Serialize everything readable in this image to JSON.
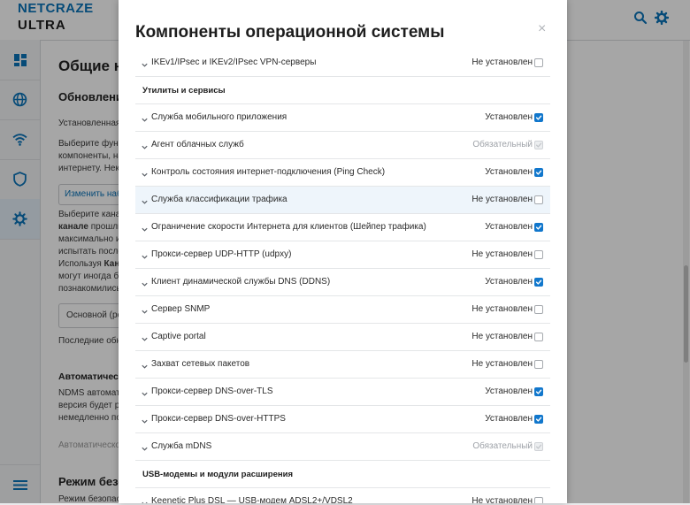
{
  "app": {
    "logo_line1": "NETCRAZE",
    "logo_line2": "ULTRA"
  },
  "topbar": {
    "icons": [
      "search-icon",
      "gear-icon"
    ]
  },
  "sidebar": {
    "items": [
      {
        "icon": "dashboard-icon"
      },
      {
        "icon": "globe-icon"
      },
      {
        "icon": "wifi-icon"
      },
      {
        "icon": "shield-icon"
      },
      {
        "icon": "gear-icon",
        "active": true
      },
      {
        "icon": "menu-icon"
      }
    ]
  },
  "background": {
    "page_title": "Общие н",
    "section_update": "Обновлени",
    "installed": "Установленная",
    "p1_l1": "Выберите функ",
    "p1_l2": "компоненты, на",
    "p1_l3": "интернету. Неко",
    "change_set_button": "Изменить набо",
    "p2_l1": "Выберите канал",
    "p2_l2_bold": "канале",
    "p2_l2": " прошли",
    "p2_l3": "максимально ис",
    "p2_l4": "испытать после",
    "p2_l5_pre": "Используя ",
    "p2_l5_bold": "Кана",
    "p2_l6": "могут иногда бы",
    "p2_l7": "познакомились",
    "channel_select": "Основной (ре",
    "last_update": "Последние обно",
    "section_auto": "Автоматическ",
    "p3_l1": "NDMS автомати",
    "p3_l2": "версия будет ра",
    "p3_l3": "немедленно пос",
    "auto_note": "Автоматическо",
    "section_safe": "Режим безо",
    "p4_l1": "Режим безопасн"
  },
  "modal": {
    "title": "Компоненты операционной системы",
    "close_label": "×",
    "rows": [
      {
        "kind": "row",
        "name": "IKEv1/IPsec и IKEv2/IPsec VPN-серверы",
        "status": "Не установлен",
        "state": "off"
      },
      {
        "kind": "section",
        "name": "Утилиты и сервисы"
      },
      {
        "kind": "row",
        "name": "Служба мобильного приложения",
        "status": "Установлен",
        "state": "on"
      },
      {
        "kind": "row",
        "name": "Агент облачных служб",
        "status": "Обязательный",
        "state": "disabled"
      },
      {
        "kind": "row",
        "name": "Контроль состояния интернет-подключения (Ping Check)",
        "status": "Установлен",
        "state": "on"
      },
      {
        "kind": "row",
        "name": "Служба классификации трафика",
        "status": "Не установлен",
        "state": "off",
        "highlight": true
      },
      {
        "kind": "row",
        "name": "Ограничение скорости Интернета для клиентов (Шейпер трафика)",
        "status": "Установлен",
        "state": "on"
      },
      {
        "kind": "row",
        "name": "Прокси-сервер UDP-HTTP (udpxy)",
        "status": "Не установлен",
        "state": "off"
      },
      {
        "kind": "row",
        "name": "Клиент динамической службы DNS (DDNS)",
        "status": "Установлен",
        "state": "on"
      },
      {
        "kind": "row",
        "name": "Сервер SNMP",
        "status": "Не установлен",
        "state": "off"
      },
      {
        "kind": "row",
        "name": "Captive portal",
        "status": "Не установлен",
        "state": "off"
      },
      {
        "kind": "row",
        "name": "Захват сетевых пакетов",
        "status": "Не установлен",
        "state": "off"
      },
      {
        "kind": "row",
        "name": "Прокси-сервер DNS-over-TLS",
        "status": "Установлен",
        "state": "on"
      },
      {
        "kind": "row",
        "name": "Прокси-сервер DNS-over-HTTPS",
        "status": "Установлен",
        "state": "on"
      },
      {
        "kind": "row",
        "name": "Служба mDNS",
        "status": "Обязательный",
        "state": "disabled"
      },
      {
        "kind": "section",
        "name": "USB-модемы и модули расширения"
      },
      {
        "kind": "row",
        "name": "Keenetic Plus DSL — USB-модем ADSL2+/VDSL2",
        "status": "Не установлен",
        "state": "off"
      }
    ]
  },
  "colors": {
    "accent": "#1177cc",
    "brand_blue": "#0a73b9",
    "muted": "#9ea2a8"
  }
}
